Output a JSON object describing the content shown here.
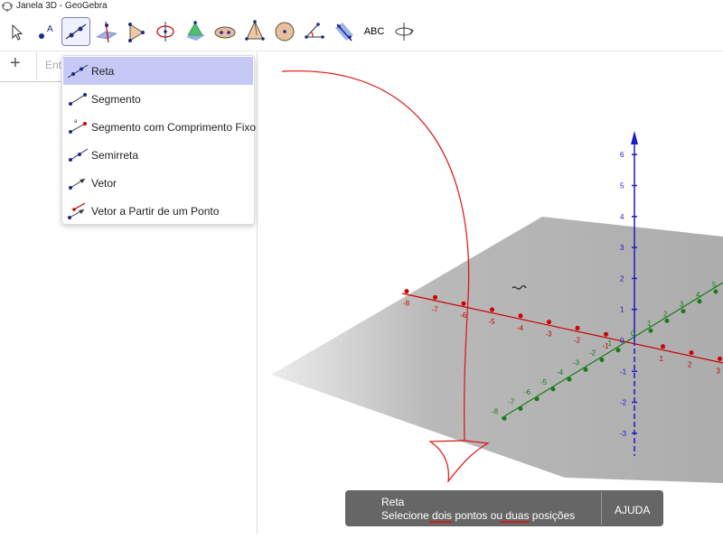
{
  "window": {
    "title": "Janela 3D - GeoGebra"
  },
  "toolbar": {
    "tools": [
      "pointer-tool",
      "point-tool",
      "line-tool",
      "perpendicular-tool",
      "polygon-tool",
      "circle-tool",
      "plane-tool",
      "conic-tool",
      "pyramid-tool",
      "sphere-tool",
      "angle-tool",
      "reflect-tool",
      "text-tool",
      "rotate-view-tool"
    ],
    "text_label": "ABC",
    "active": "line-tool"
  },
  "algebra": {
    "add_label": "+",
    "input_placeholder": "Ent"
  },
  "menu": {
    "items": [
      "Reta",
      "Segmento",
      "Segmento com Comprimento Fixo",
      "Semirreta",
      "Vetor",
      "Vetor a Partir de um Ponto"
    ],
    "active_index": 0
  },
  "axes": {
    "x_labels": [
      "-8",
      "-7",
      "-6",
      "-5",
      "-4",
      "-3",
      "-2",
      "-1",
      "1",
      "2",
      "3"
    ],
    "y_labels": [
      "-8",
      "-7",
      "-6",
      "-5",
      "-4",
      "-3",
      "-2",
      "-1",
      "0",
      "1",
      "2",
      "3",
      "4",
      "5"
    ],
    "z_labels": [
      "6",
      "5",
      "4",
      "3",
      "2",
      "1",
      "0",
      "-1",
      "-2",
      "-3"
    ],
    "colors": {
      "x": "#cc0000",
      "y": "#1a7a1a",
      "z": "#1a1acc"
    }
  },
  "status": {
    "tool_name": "Reta",
    "hint": "Selecione dois pontos ou duas posições",
    "help_label": "AJUDA"
  }
}
